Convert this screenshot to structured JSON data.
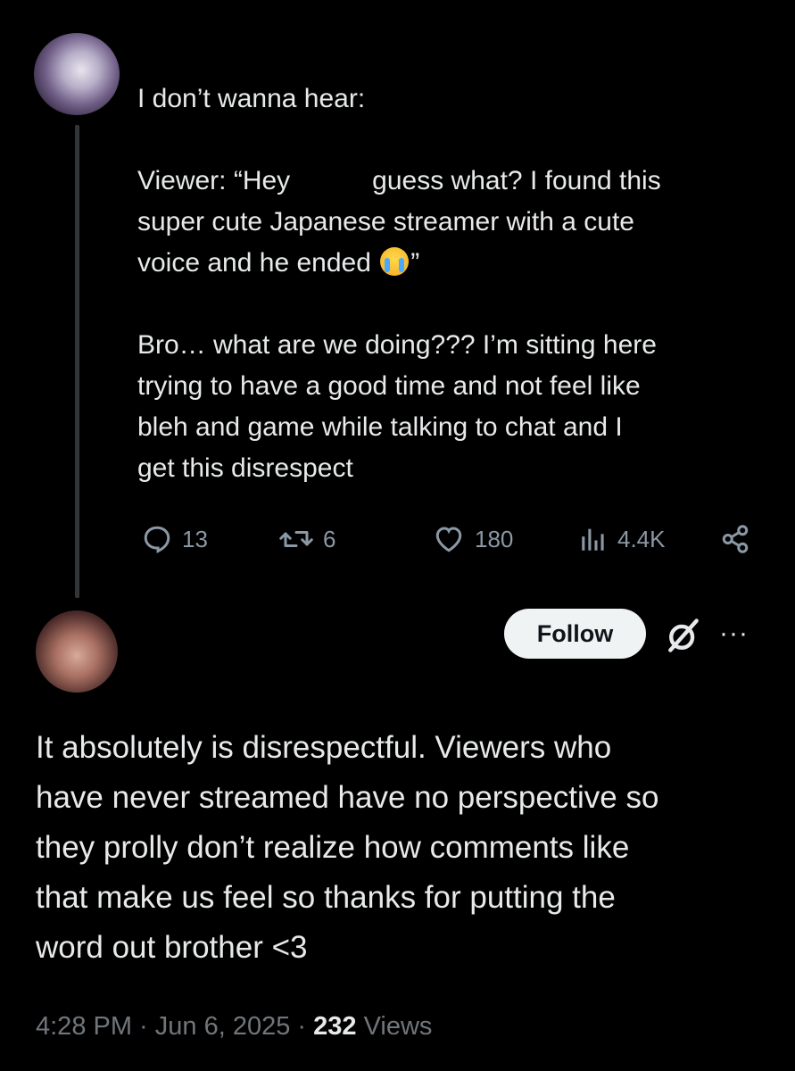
{
  "parent_tweet": {
    "lines": [
      "I don’t wanna hear:",
      "",
      "Viewer: “Hey",
      "guess what? I found this",
      "super cute Japanese streamer with a cute",
      "voice and he ended",
      "”",
      "",
      "Bro… what are we doing??? I’m sitting here",
      "trying to have a good time and not feel like",
      "bleh and game while talking to chat and I",
      "get this disrespect"
    ],
    "emoji": "loudly-crying-face",
    "actions": {
      "replies": "13",
      "reposts": "6",
      "likes": "180",
      "views": "4.4K"
    }
  },
  "reply": {
    "follow_label": "Follow",
    "more_label": "···",
    "text_lines": [
      "It absolutely is disrespectful. Viewers who",
      "have never streamed have no perspective so",
      "they prolly don’t realize how comments like",
      "that make us feel so thanks for putting the",
      "word out brother <3"
    ],
    "timestamp": "4:28 PM · Jun 6, 2025 · ",
    "views_count": "232",
    "views_label": " Views"
  },
  "colors": {
    "background": "#000000",
    "text": "#e7e9ea",
    "muted": "#71767b",
    "follow_bg": "#eff3f4"
  }
}
